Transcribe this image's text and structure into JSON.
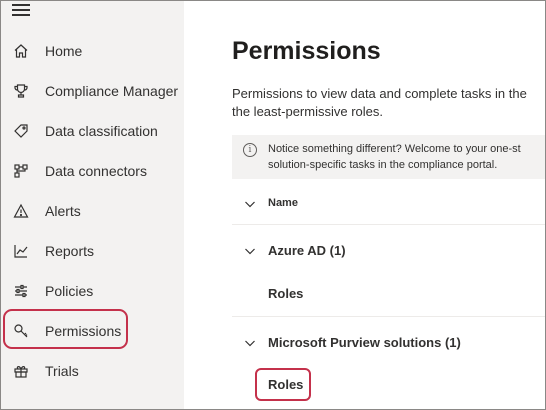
{
  "sidebar": {
    "items": [
      {
        "label": "Home",
        "icon": "home-icon"
      },
      {
        "label": "Compliance Manager",
        "icon": "trophy-icon"
      },
      {
        "label": "Data classification",
        "icon": "tag-icon"
      },
      {
        "label": "Data connectors",
        "icon": "connector-icon"
      },
      {
        "label": "Alerts",
        "icon": "warning-icon"
      },
      {
        "label": "Reports",
        "icon": "chart-icon"
      },
      {
        "label": "Policies",
        "icon": "sliders-icon"
      },
      {
        "label": "Permissions",
        "icon": "key-icon"
      },
      {
        "label": "Trials",
        "icon": "gift-icon"
      }
    ],
    "selected": "Permissions"
  },
  "main": {
    "title": "Permissions",
    "description_line1": "Permissions to view data and complete tasks in the",
    "description_line2": "the least-permissive roles.",
    "notice_line1": "Notice something different? Welcome to your one-st",
    "notice_line2": "solution-specific tasks in the compliance portal.",
    "header_label": "Name",
    "groups": [
      {
        "label": "Azure AD (1)",
        "child": "Roles"
      },
      {
        "label": "Microsoft Purview solutions (1)",
        "child": "Roles"
      }
    ]
  },
  "colors": {
    "sidebar_bg": "#f3f2f1",
    "highlight": "#c4314b",
    "text": "#323130"
  }
}
